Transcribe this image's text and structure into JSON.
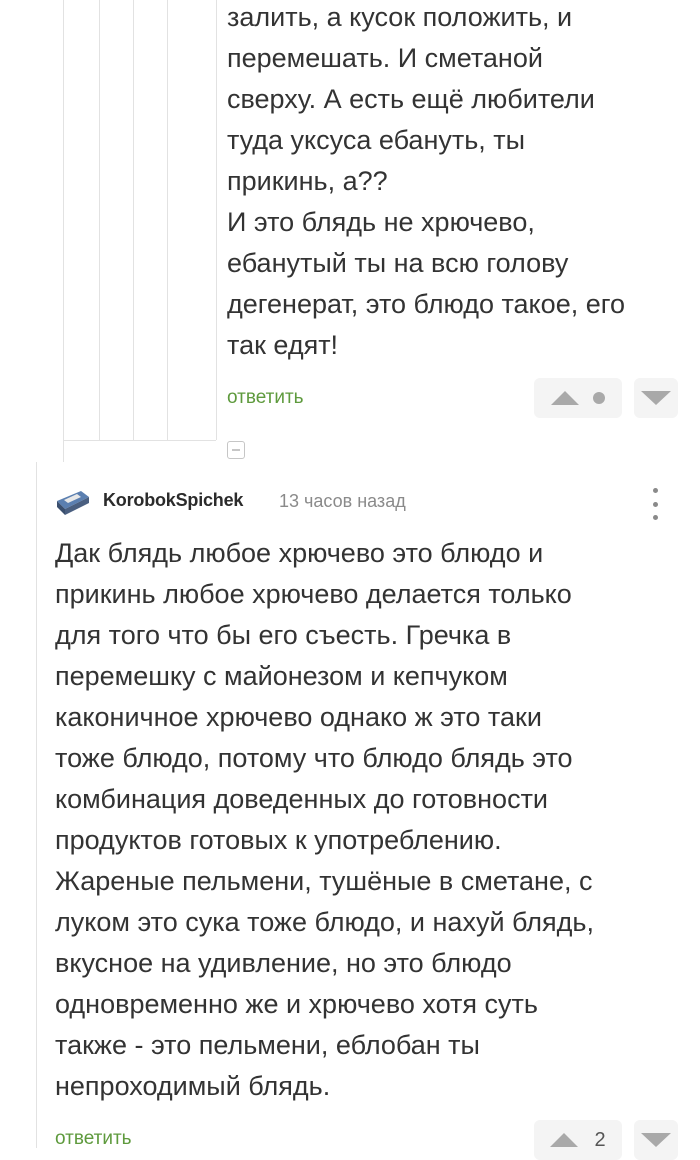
{
  "comment_top": {
    "text": "залить, а кусок положить, и\nперемешать. И сметаной\nсверху. А есть ещё любители\nтуда уксуса ебануть, ты\nприкинь, а??\nИ это блядь не хрючево,\nебанутый ты на всю голову\nдегенерат, это блюдо такое, его\nтак едят!",
    "reply_label": "ответить"
  },
  "comment_main": {
    "author": "KorobokSpichek",
    "time": "13 часов назад",
    "text": "Дак блядь любое хрючево это блюдо и\nприкинь любое хрючево делается только\nдля того что бы его съесть. Гречка в\nперемешку с майонезом и кепчуком\nкаконичное хрючево однако ж это таки\nтоже блюдо, потому что блюдо блядь это\nкомбинация доведенных до готовности\nпродуктов готовых к употреблению.\nЖареные пельмени, тушёные в сметане, с\nлуком это сука тоже блюдо, и нахуй блядь,\nвкусное на удивление, но это блюдо\nодновременно же и хрючево хотя суть\nтакже - это пельмени, еблобан ты\nнепроходимый блядь.",
    "reply_label": "ответить",
    "score": "2"
  },
  "colors": {
    "reply_green": "#5e9a3d",
    "vote_gray": "#a9a9a9",
    "thread_line": "#e2e2e2"
  },
  "icons": {
    "upvote": "triangle-up-icon",
    "downvote": "triangle-down-icon",
    "neutral": "dot-icon",
    "more": "vertical-dots-icon",
    "collapse": "minus-square-icon",
    "avatar": "matchbox-avatar"
  }
}
